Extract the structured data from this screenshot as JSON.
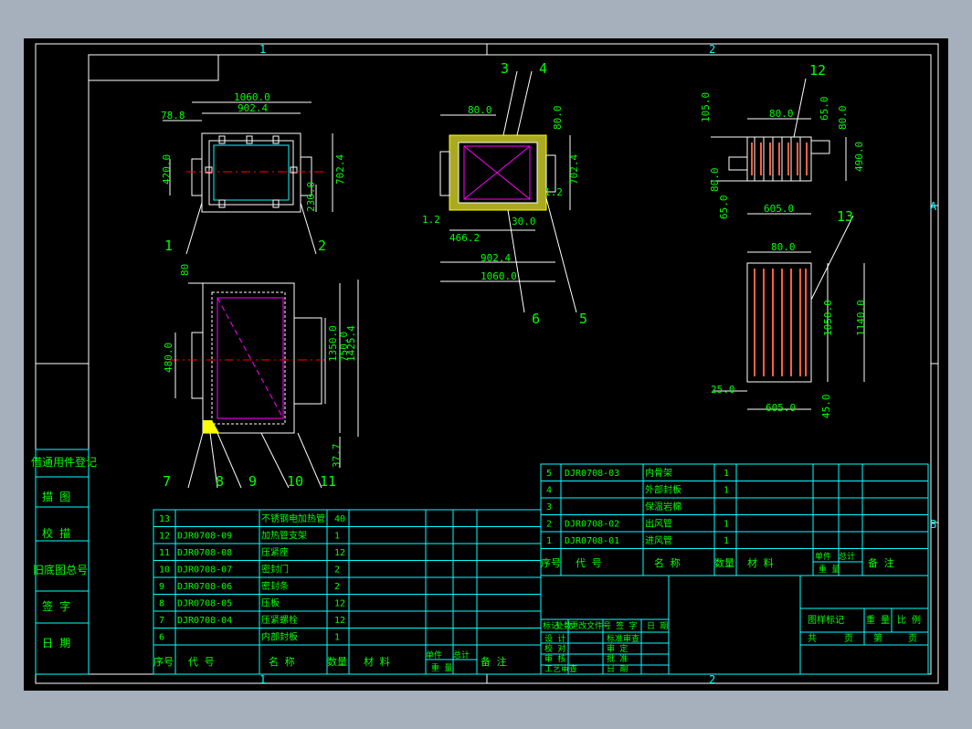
{
  "colors": {
    "frame": "#ffffff",
    "border": "#00ffff",
    "dim": "#ffffff",
    "text": "#00ff00",
    "table": "#00ffff",
    "center": "#ff0000",
    "part": "#ff00ff",
    "insulation": "#ffff00",
    "heater": "#ff6040"
  },
  "zones": {
    "top": [
      "1",
      "2"
    ],
    "bottom": [
      "1",
      "2"
    ],
    "right": [
      "A",
      "B"
    ]
  },
  "left_block": [
    "借通用件登记",
    "描 图",
    "校 描",
    "旧底图总号",
    "签 字",
    "日 期"
  ],
  "dims": {
    "view1": [
      "1060.0",
      "902.4",
      "78.8",
      "420.0",
      "702.4",
      "230.0"
    ],
    "view2": [
      "80.0",
      "80.0",
      "702.4",
      "1.2",
      "30.0",
      "466.2",
      "1.2",
      "902.4",
      "1060.0"
    ],
    "view3": [
      "105.0",
      "80.0",
      "65.0",
      "80.0",
      "490.0",
      "80.0",
      "65.0",
      "605.0"
    ],
    "view4": [
      "80.0",
      "1050.0",
      "1140.0",
      "25.0",
      "605.0",
      "45.0"
    ],
    "view5": [
      "80",
      "480.0",
      "750.0",
      "1350.0",
      "1425.4",
      "37.7"
    ]
  },
  "callouts": [
    "1",
    "2",
    "3",
    "4",
    "5",
    "6",
    "7",
    "8",
    "9",
    "10",
    "11",
    "12",
    "13"
  ],
  "bom_left": {
    "rows": [
      [
        "13",
        "",
        "不锈钢电加热管",
        "40"
      ],
      [
        "12",
        "DJR0708-09",
        "加热管支架",
        "1"
      ],
      [
        "11",
        "DJR0708-08",
        "压紧座",
        "12"
      ],
      [
        "10",
        "DJR0708-07",
        "密封门",
        "2"
      ],
      [
        "9",
        "DJR0708-06",
        "密封条",
        "2"
      ],
      [
        "8",
        "DJR0708-05",
        "压板",
        "12"
      ],
      [
        "7",
        "DJR0708-04",
        "压紧螺栓",
        "12"
      ],
      [
        "6",
        "",
        "内部封板",
        "1"
      ]
    ],
    "header": [
      "序号",
      "代    号",
      "名    称",
      "数量",
      "材     料",
      "单件",
      "总计",
      "重    量",
      "备     注"
    ]
  },
  "bom_right": {
    "rows": [
      [
        "5",
        "DJR0708-03",
        "内骨架",
        "1"
      ],
      [
        "4",
        "",
        "外部封板",
        "1"
      ],
      [
        "3",
        "",
        "保温岩棉",
        ""
      ],
      [
        "2",
        "DJR0708-02",
        "出风管",
        "1"
      ],
      [
        "1",
        "DJR0708-01",
        "进风管",
        "1"
      ]
    ],
    "header": [
      "序号",
      "代    号",
      "名    称",
      "数量",
      "材     料",
      "单件",
      "总计",
      "重    量",
      "备     注"
    ]
  },
  "title_block": {
    "left_rows": [
      "标记",
      "处数",
      "更改文件号",
      "签 字",
      "日 期"
    ],
    "sign": [
      "设 计",
      "校 对",
      "审 核",
      "工艺审查"
    ],
    "sign2": [
      "标准审查",
      "审 定",
      "批 准",
      "日 期"
    ],
    "right": [
      "图样标记",
      "重 量",
      "比 例",
      "共",
      "页",
      "第",
      "页"
    ]
  }
}
